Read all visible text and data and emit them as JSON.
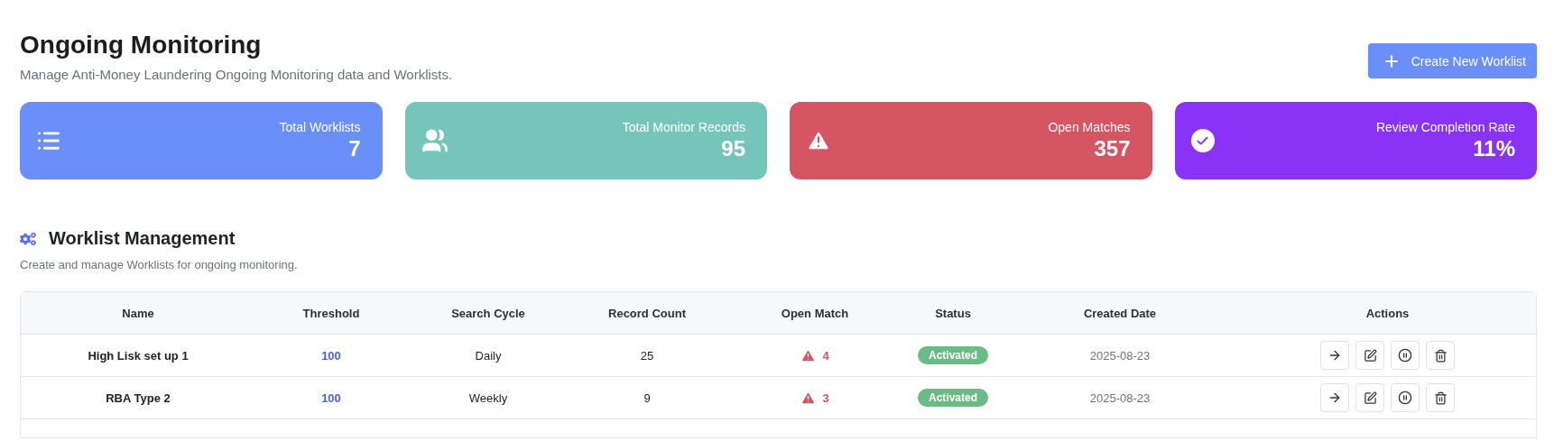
{
  "header": {
    "title": "Ongoing Monitoring",
    "subtitle": "Manage Anti-Money Laundering Ongoing Monitoring data and Worklists.",
    "create_button": "Create New Worklist"
  },
  "stats": [
    {
      "kind": "worklists",
      "label": "Total Worklists",
      "value": "7",
      "color": "#6b8ff8"
    },
    {
      "kind": "records",
      "label": "Total Monitor Records",
      "value": "95",
      "color": "#75c5bb"
    },
    {
      "kind": "matches",
      "label": "Open Matches",
      "value": "357",
      "color": "#d55563"
    },
    {
      "kind": "completion",
      "label": "Review Completion Rate",
      "value": "11%",
      "color": "#8833f5"
    }
  ],
  "section": {
    "title": "Worklist Management",
    "subtitle": "Create and manage Worklists for ongoing monitoring."
  },
  "table": {
    "columns": [
      "Name",
      "Threshold",
      "Search Cycle",
      "Record Count",
      "Open Match",
      "Status",
      "Created Date",
      "Actions"
    ],
    "rows": [
      {
        "name": "High Lisk set up 1",
        "threshold": "100",
        "search_cycle": "Daily",
        "record_count": "25",
        "open_match": "4",
        "status": {
          "label": "Activated",
          "kind": "active"
        },
        "created_date": "2025-08-23"
      },
      {
        "name": "RBA Type 2",
        "threshold": "100",
        "search_cycle": "Weekly",
        "record_count": "9",
        "open_match": "3",
        "status": {
          "label": "Activated",
          "kind": "active"
        },
        "created_date": "2025-08-23"
      }
    ]
  }
}
